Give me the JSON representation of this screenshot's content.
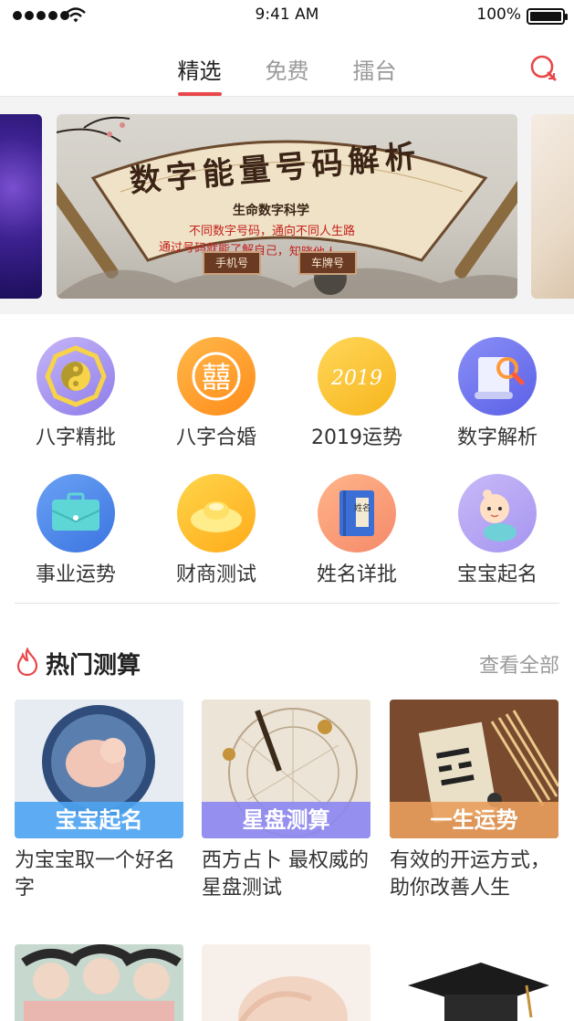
{
  "status_bar": {
    "time": "9:41 AM",
    "battery": "100%"
  },
  "tabs": [
    {
      "label": "精选",
      "active": true
    },
    {
      "label": "免费",
      "active": false
    },
    {
      "label": "擂台",
      "active": false
    }
  ],
  "banner": {
    "title": "数字能量号码解析",
    "subtitle": "生命数字科学",
    "line1": "不同数字号码，通向不同人生路",
    "line2": "通过号码就能了解自己，知晓他人。",
    "btn_phone": "手机号",
    "btn_car": "车牌号"
  },
  "features": [
    {
      "label": "八字精批",
      "icon": "bagua-icon"
    },
    {
      "label": "八字合婚",
      "icon": "double-happiness-icon"
    },
    {
      "label": "2019运势",
      "icon": "2019-icon",
      "icon_text": "2019"
    },
    {
      "label": "数字解析",
      "icon": "scroll-magnifier-icon"
    },
    {
      "label": "事业运势",
      "icon": "briefcase-icon"
    },
    {
      "label": "财商测试",
      "icon": "gold-ingot-icon"
    },
    {
      "label": "姓名详批",
      "icon": "name-book-icon",
      "icon_text": "姓名"
    },
    {
      "label": "宝宝起名",
      "icon": "baby-icon"
    }
  ],
  "hot": {
    "title": "热门测算",
    "view_all": "查看全部",
    "cards": [
      {
        "ribbon": "宝宝起名",
        "desc": "为宝宝取一个好名字",
        "ribbon_color": "#4ea4f2"
      },
      {
        "ribbon": "星盘测算",
        "desc": "西方占卜 最权威的星盘测试",
        "ribbon_color": "#8c86f2"
      },
      {
        "ribbon": "一生运势",
        "desc": "有效的开运方式，助你改善人生",
        "ribbon_color": "#e89f5c"
      }
    ]
  },
  "colors": {
    "accent": "#e8474a"
  }
}
